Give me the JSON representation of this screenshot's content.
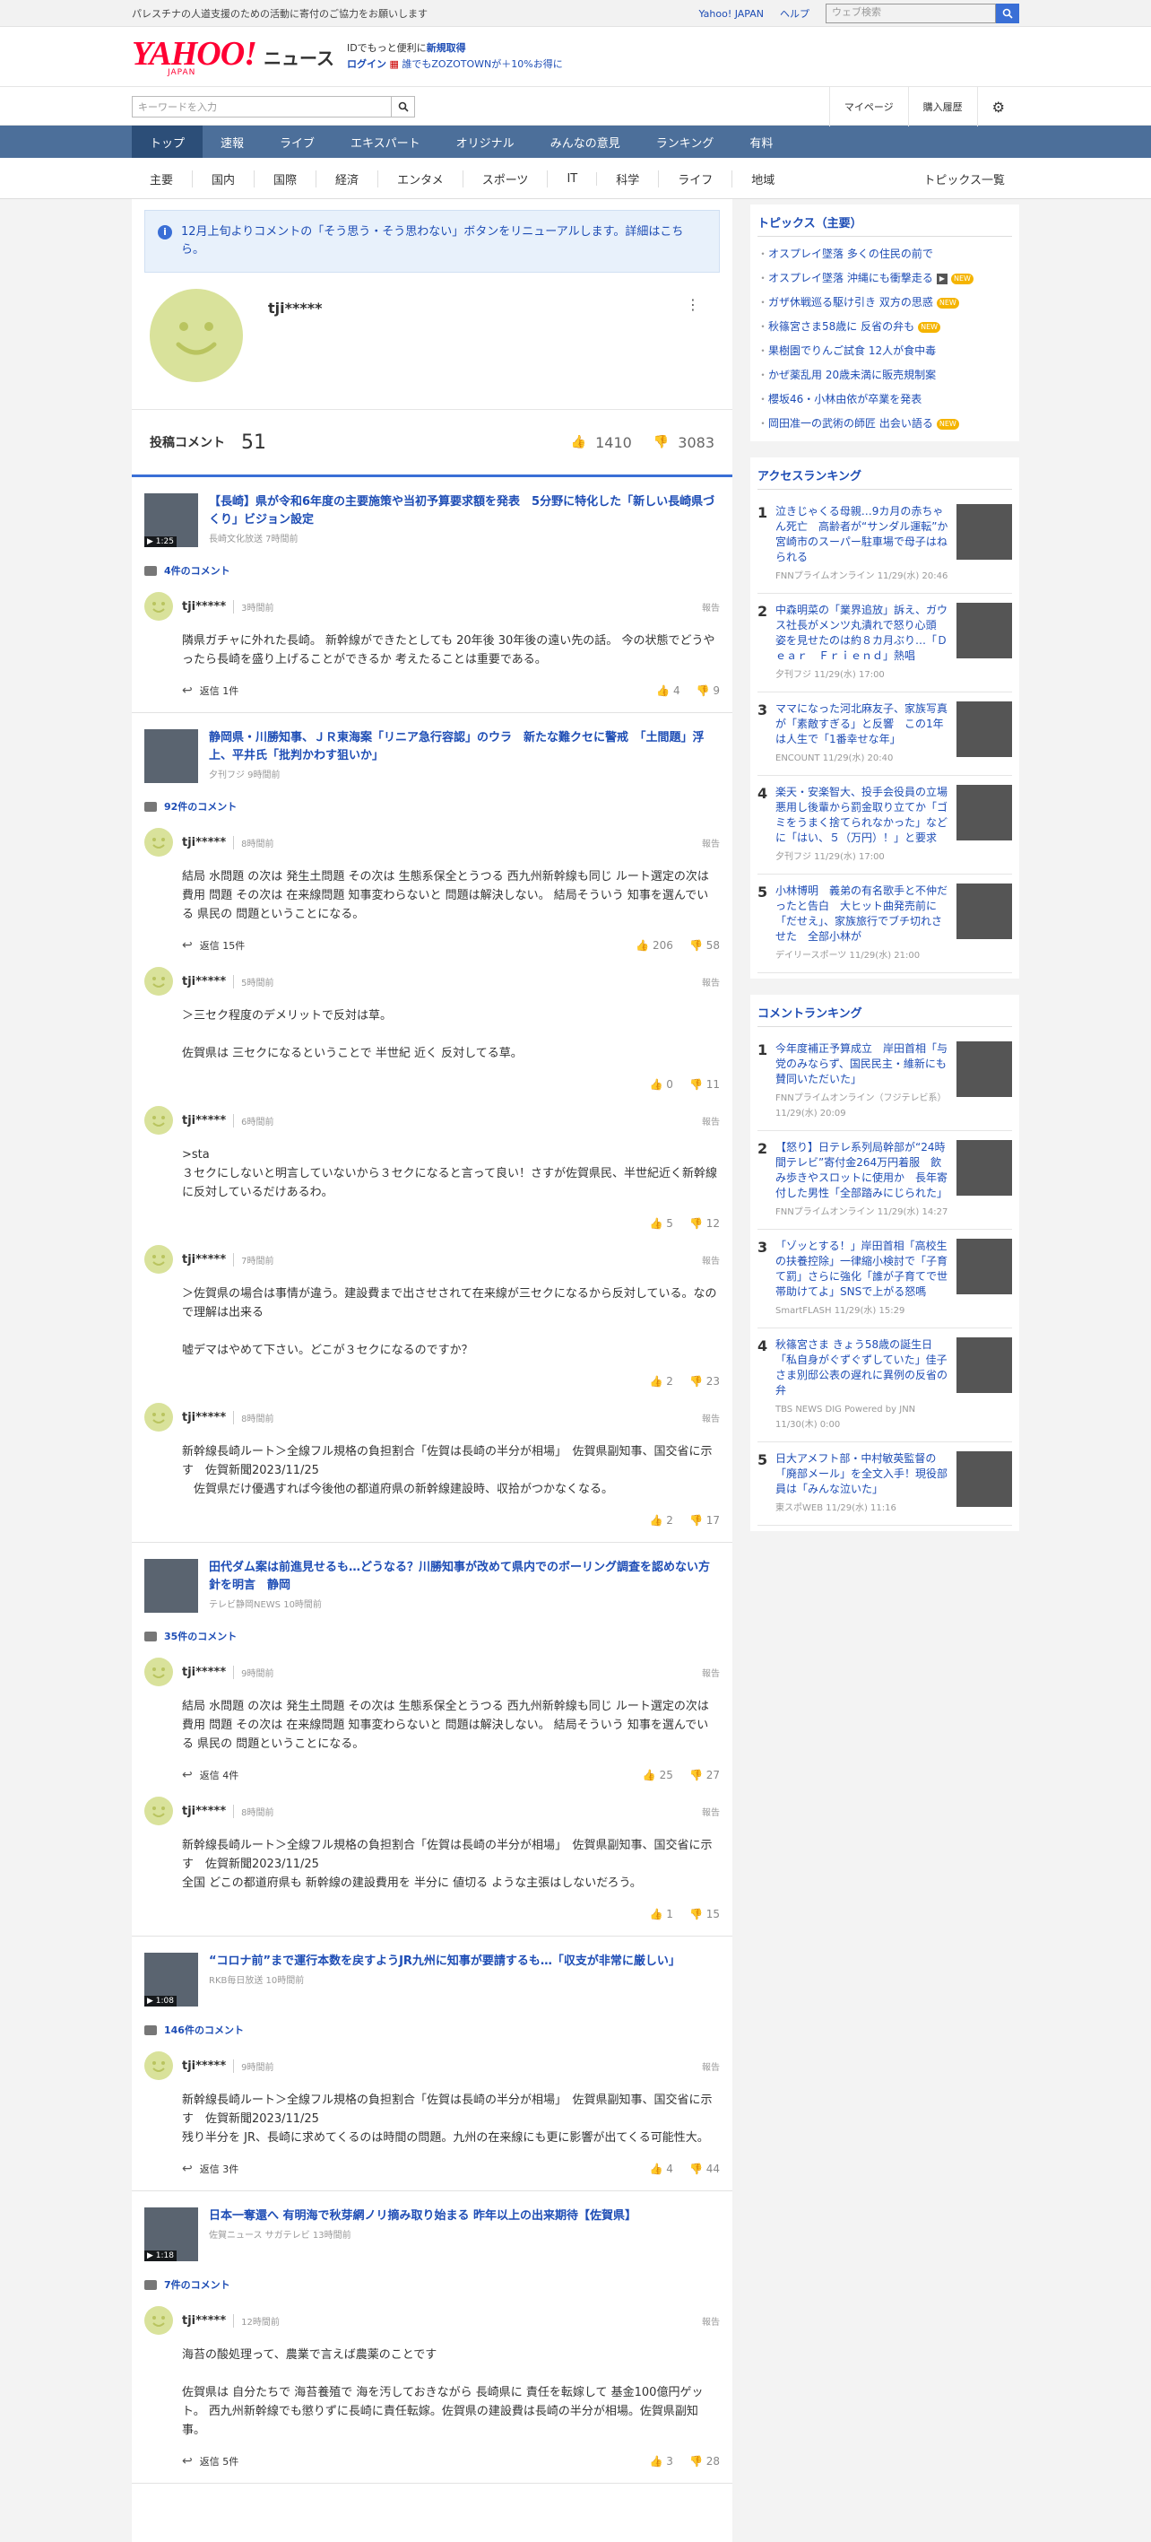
{
  "notice": "パレスチナの人道支援のための活動に寄付のご協力をお願いします",
  "top_links": [
    "Yahoo! JAPAN",
    "ヘルプ"
  ],
  "web_search_placeholder": "ウェブ検索",
  "logo": {
    "main": "YAHOO!",
    "sub": "JAPAN",
    "news": "ニュース"
  },
  "login": {
    "line1_prefix": "IDでもっと便利に",
    "line1_link": "新規取得",
    "line2_link": "ログイン",
    "line2_text": "誰でもZOZOTOWNが＋10%お得に"
  },
  "keyword_placeholder": "キーワードを入力",
  "right_tools": [
    "マイページ",
    "購入履歴"
  ],
  "main_tabs": [
    "トップ",
    "速報",
    "ライブ",
    "エキスパート",
    "オリジナル",
    "みんなの意見",
    "ランキング",
    "有料"
  ],
  "categories": [
    "主要",
    "国内",
    "国際",
    "経済",
    "エンタメ",
    "スポーツ",
    "IT",
    "科学",
    "ライフ",
    "地域"
  ],
  "topics_list_link": "トピックス一覧",
  "info_message": "12月上旬よりコメントの「そう思う・そう思わない」ボタンをリニューアルします。詳細はこちら。",
  "profile": {
    "name": "tji*****",
    "posts_label": "投稿コメント",
    "posts_count": "51",
    "likes": "1410",
    "dislikes": "3083"
  },
  "articles": [
    {
      "title": "【長崎】県が令和6年度の主要施策や当初予算要求額を発表　5分野に特化した「新しい長崎県づくり」ビジョン設定",
      "source": "長崎文化放送 7時間前",
      "duration": "1:25",
      "comment_count": "4件のコメント",
      "comments": [
        {
          "name": "tji*****",
          "time": "3時間前",
          "body": "隣県ガチャに外れた長崎。 新幹線ができたとしても 20年後 30年後の遠い先の話。 今の状態でどうやったら長崎を盛り上げることができるか 考えたることは重要である。",
          "replies": "返信 1件",
          "up": "4",
          "down": "9"
        }
      ]
    },
    {
      "title": "静岡県・川勝知事、ＪＲ東海案「リニア急行容認」のウラ　新たな難クセに警戒　「土間題」浮上、平井氏「批判かわす狙いか」",
      "source": "夕刊フジ 9時間前",
      "duration": "",
      "comment_count": "92件のコメント",
      "comments": [
        {
          "name": "tji*****",
          "time": "8時間前",
          "body": "結局 水問題 の次は 発生土問題 その次は 生態系保全とうつる 西九州新幹線も同じ ルート選定の次は 費用 問題 その次は 在来線問題 知事変わらないと 問題は解決しない。 結局そういう 知事を選んでいる 県民の 問題ということになる。",
          "replies": "返信 15件",
          "up": "206",
          "down": "58"
        },
        {
          "name": "tji*****",
          "time": "5時間前",
          "body": "＞三セク程度のデメリットで反対は草。\n\n佐賀県は 三セクになるということで 半世紀 近く 反対してる草。",
          "replies": "",
          "up": "0",
          "down": "11"
        },
        {
          "name": "tji*****",
          "time": "6時間前",
          "body": ">sta\n３セクにしないと明言していないから３セクになると言って良い！さすが佐賀県民、半世紀近く新幹線に反対しているだけあるわ。",
          "replies": "",
          "up": "5",
          "down": "12"
        },
        {
          "name": "tji*****",
          "time": "7時間前",
          "body": "＞佐賀県の場合は事情が違う。建設費まで出させされて在来線が三セクになるから反対している。なので理解は出来る\n\n嘘デマはやめて下さい。どこが３セクになるのですか？",
          "replies": "",
          "up": "2",
          "down": "23"
        },
        {
          "name": "tji*****",
          "time": "8時間前",
          "body": "新幹線長崎ルート＞全線フル規格の負担割合「佐賀は長崎の半分が相場」　佐賀県副知事、国交省に示す　佐賀新聞2023/11/25\n　佐賀県だけ優遇すれば今後他の都道府県の新幹線建設時、収拾がつかなくなる。",
          "replies": "",
          "up": "2",
          "down": "17"
        }
      ]
    },
    {
      "title": "田代ダム案は前進見せるも…どうなる？川勝知事が改めて県内でのボーリング調査を認めない方針を明言　静岡",
      "source": "テレビ静岡NEWS 10時間前",
      "duration": "",
      "comment_count": "35件のコメント",
      "comments": [
        {
          "name": "tji*****",
          "time": "9時間前",
          "body": "結局 水問題 の次は 発生土問題 その次は 生態系保全とうつる 西九州新幹線も同じ ルート選定の次は 費用 問題 その次は 在来線問題 知事変わらないと 問題は解決しない。 結局そういう 知事を選んでいる 県民の 問題ということになる。",
          "replies": "返信 4件",
          "up": "25",
          "down": "27"
        },
        {
          "name": "tji*****",
          "time": "8時間前",
          "body": "新幹線長崎ルート＞全線フル規格の負担割合「佐賀は長崎の半分が相場」　佐賀県副知事、国交省に示す　佐賀新聞2023/11/25\n全国 どこの都道府県も 新幹線の建設費用を 半分に 値切る ような主張はしないだろう。",
          "replies": "",
          "up": "1",
          "down": "15"
        }
      ]
    },
    {
      "title": "“コロナ前”まで運行本数を戻すようJR九州に知事が要請するも…「収支が非常に厳しい」",
      "source": "RKB毎日放送 10時間前",
      "duration": "1:08",
      "comment_count": "146件のコメント",
      "comments": [
        {
          "name": "tji*****",
          "time": "9時間前",
          "body": "新幹線長崎ルート＞全線フル規格の負担割合「佐賀は長崎の半分が相場」　佐賀県副知事、国交省に示す　佐賀新聞2023/11/25\n残り半分を JR、長崎に求めてくるのは時間の問題。九州の在来線にも更に影響が出てくる可能性大。",
          "replies": "返信 3件",
          "up": "4",
          "down": "44"
        }
      ]
    },
    {
      "title": "日本一奪還へ 有明海で秋芽網ノリ摘み取り始まる 昨年以上の出来期待【佐賀県】",
      "source": "佐賀ニュース サガテレビ 13時間前",
      "duration": "1:18",
      "comment_count": "7件のコメント",
      "comments": [
        {
          "name": "tji*****",
          "time": "12時間前",
          "body": "海苔の酸処理って、農業で言えば農薬のことです\n\n佐賀県は 自分たちで 海苔養殖で 海を汚しておきながら 長崎県に 責任を転嫁して 基金100億円ゲット。 西九州新幹線でも懲りずに長崎に責任転嫁。佐賀県の建設費は長崎の半分が相場。佐賀県副知事。",
          "replies": "返信 5件",
          "up": "3",
          "down": "28"
        }
      ]
    }
  ],
  "topics": {
    "title": "トピックス（主要）",
    "items": [
      {
        "text": "オスプレイ墜落 多くの住民の前で",
        "tag": ""
      },
      {
        "text": "オスプレイ墜落 沖縄にも衝撃走る",
        "tag": "NEW",
        "video": true
      },
      {
        "text": "ガザ休戦巡る駆け引き 双方の思惑",
        "tag": "NEW"
      },
      {
        "text": "秋篠宮さま58歳に 反省の弁も",
        "tag": "NEW"
      },
      {
        "text": "果樹園でりんご試食 12人が食中毒",
        "tag": ""
      },
      {
        "text": "かぜ薬乱用 20歳未満に販売規制案",
        "tag": ""
      },
      {
        "text": "櫻坂46・小林由依が卒業を発表",
        "tag": ""
      },
      {
        "text": "岡田准一の武術の師匠 出会い語る",
        "tag": "NEW"
      }
    ]
  },
  "access_ranking": {
    "title": "アクセスランキング",
    "items": [
      {
        "text": "泣きじゃくる母親…9カ月の赤ちゃん死亡　高齢者が“サンダル運転”か　宮崎市のスーパー駐車場で母子はねられる",
        "src": "FNNプライムオンライン 11/29(水) 20:46"
      },
      {
        "text": "中森明菜の「業界追放」訴え、ガウス社長がメンツ丸潰れで怒り心頭　姿を見せたのは約８カ月ぶり…「Ｄｅａｒ　Ｆｒｉｅｎｄ」熱唱",
        "src": "夕刊フジ 11/29(水) 17:00"
      },
      {
        "text": "ママになった河北麻友子、家族写真が「素敵すぎる」と反響　この1年は人生で「1番幸せな年」",
        "src": "ENCOUNT 11/29(水) 20:40"
      },
      {
        "text": "楽天・安楽智大、投手会役員の立場悪用し後輩から罰金取り立てか「ゴミをうまく捨てられなかった」などに「はい、５（万円）！」と要求",
        "src": "夕刊フジ 11/29(水) 17:00"
      },
      {
        "text": "小林博明　義弟の有名歌手と不仲だったと告白　大ヒット曲発売前に「だせえ」、家族旅行でブチ切れさせた　全部小林が",
        "src": "デイリースポーツ 11/29(水) 21:00"
      }
    ]
  },
  "comment_ranking": {
    "title": "コメントランキング",
    "items": [
      {
        "text": "今年度補正予算成立　岸田首相「与党のみならず、国民民主・維新にも賛同いただいた」",
        "src": "FNNプライムオンライン（フジテレビ系） 11/29(水) 20:09"
      },
      {
        "text": "【怒り】日テレ系列局幹部が“24時間テレビ”寄付金264万円着服　飲み歩きやスロットに使用か　長年寄付した男性「全部踏みにじられた」",
        "src": "FNNプライムオンライン 11/29(水) 14:27"
      },
      {
        "text": "「ゾッとする！」岸田首相「高校生の扶養控除」一律縮小検討で「子育て罰」さらに強化「誰が子育てで世帯助けてよ」SNSで上がる怒嗎",
        "src": "SmartFLASH 11/29(水) 15:29"
      },
      {
        "text": "秋篠宮さま きょう58歳の誕生日「私自身がぐずぐずしていた」佳子さま別邸公表の遅れに異例の反省の弁",
        "src": "TBS NEWS DIG Powered by JNN 11/30(木) 0:00"
      },
      {
        "text": "日大アメフト部・中村敏英監督の「廃部メール」を全文入手！現役部員は「みんな泣いた」",
        "src": "東スポWEB 11/29(水) 11:16"
      }
    ]
  }
}
